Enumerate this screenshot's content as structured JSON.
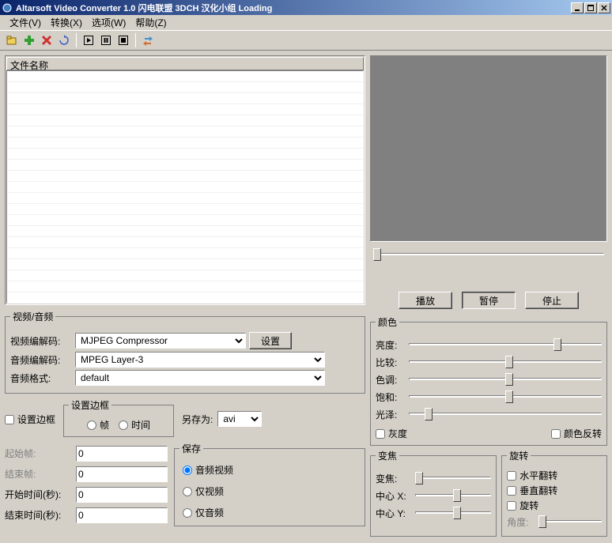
{
  "window": {
    "title": "Altarsoft Video Converter 1.0 闪电联盟 3DCH 汉化小组 Loading"
  },
  "menu": {
    "file": "文件(V)",
    "convert": "转换(X)",
    "options": "选项(W)",
    "help": "帮助(Z)"
  },
  "fileList": {
    "header": "文件名称"
  },
  "videoAudio": {
    "legend": "视频/音频",
    "videoCodecLabel": "视频编解码:",
    "videoCodec": "MJPEG Compressor",
    "settingsBtn": "设置",
    "audioCodecLabel": "音频编解码:",
    "audioCodec": "MPEG Layer-3",
    "audioFormatLabel": "音频格式:",
    "audioFormat": "default"
  },
  "border": {
    "setBorderChk": "设置边框",
    "fsLegend": "设置边框",
    "radFrame": "帧",
    "radTime": "时间",
    "saveAsLabel": "另存为:",
    "saveAs": "avi"
  },
  "time": {
    "startFrame": "起始帧:",
    "endFrame": "结束帧:",
    "startTime": "开始时间(秒):",
    "endTime": "结束时间(秒):",
    "v1": "0",
    "v2": "0",
    "v3": "0",
    "v4": "0"
  },
  "save": {
    "legend": "保存",
    "av": "音频视频",
    "video": "仅视频",
    "audio": "仅音频"
  },
  "playback": {
    "play": "播放",
    "pause": "暂停",
    "stop": "停止"
  },
  "color": {
    "legend": "颜色",
    "brightness": "亮度:",
    "contrast": "比较:",
    "hue": "色调:",
    "saturation": "饱和:",
    "gamma": "光泽:",
    "grayscale": "灰度",
    "invert": "颜色反转"
  },
  "zoom": {
    "legend": "变焦",
    "zoom": "变焦:",
    "centerX": "中心 X:",
    "centerY": "中心 Y:"
  },
  "rotate": {
    "legend": "旋转",
    "flipH": "水平翻转",
    "flipV": "垂直翻转",
    "rotate": "旋转",
    "angle": "角度:"
  }
}
